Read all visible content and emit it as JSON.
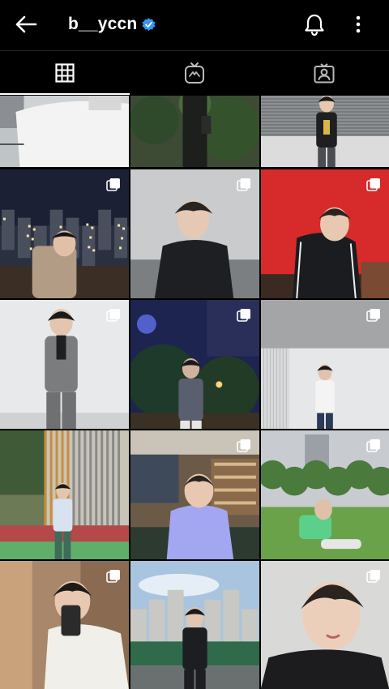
{
  "profile": {
    "username": "b__yccn",
    "verified": true,
    "back_icon": "arrow-left-icon",
    "notification_icon": "bell-icon",
    "more_icon": "more-vertical-icon"
  },
  "tabs": [
    {
      "icon": "grid-icon",
      "active": true
    },
    {
      "icon": "igtv-icon",
      "active": false
    },
    {
      "icon": "tagged-user-icon",
      "active": false
    }
  ],
  "colors": {
    "background": "#000000",
    "text": "#ffffff",
    "verified_badge": "#3897f0",
    "divider": "#262626"
  },
  "posts": [
    {
      "scene": "white-tshirt-balcony",
      "multi": false
    },
    {
      "scene": "trees-black-outfit",
      "multi": false
    },
    {
      "scene": "shutter-standing",
      "multi": false
    },
    {
      "scene": "night-city-rooftop",
      "multi": true
    },
    {
      "scene": "grey-wall-black-shirt",
      "multi": true
    },
    {
      "scene": "red-wall-tracksuit",
      "multi": true
    },
    {
      "scene": "grey-suit-white-wall",
      "multi": true
    },
    {
      "scene": "night-blue-light",
      "multi": true
    },
    {
      "scene": "concrete-wall-white-shirt",
      "multi": true
    },
    {
      "scene": "wooden-slats-campus",
      "multi": false
    },
    {
      "scene": "cafe-lavender-tshirt",
      "multi": true
    },
    {
      "scene": "park-green-tshirt",
      "multi": true
    },
    {
      "scene": "mirror-selfie-white-jacket",
      "multi": true
    },
    {
      "scene": "rooftop-black-suit",
      "multi": false
    },
    {
      "scene": "selfie-black-tshirt",
      "multi": true
    }
  ]
}
